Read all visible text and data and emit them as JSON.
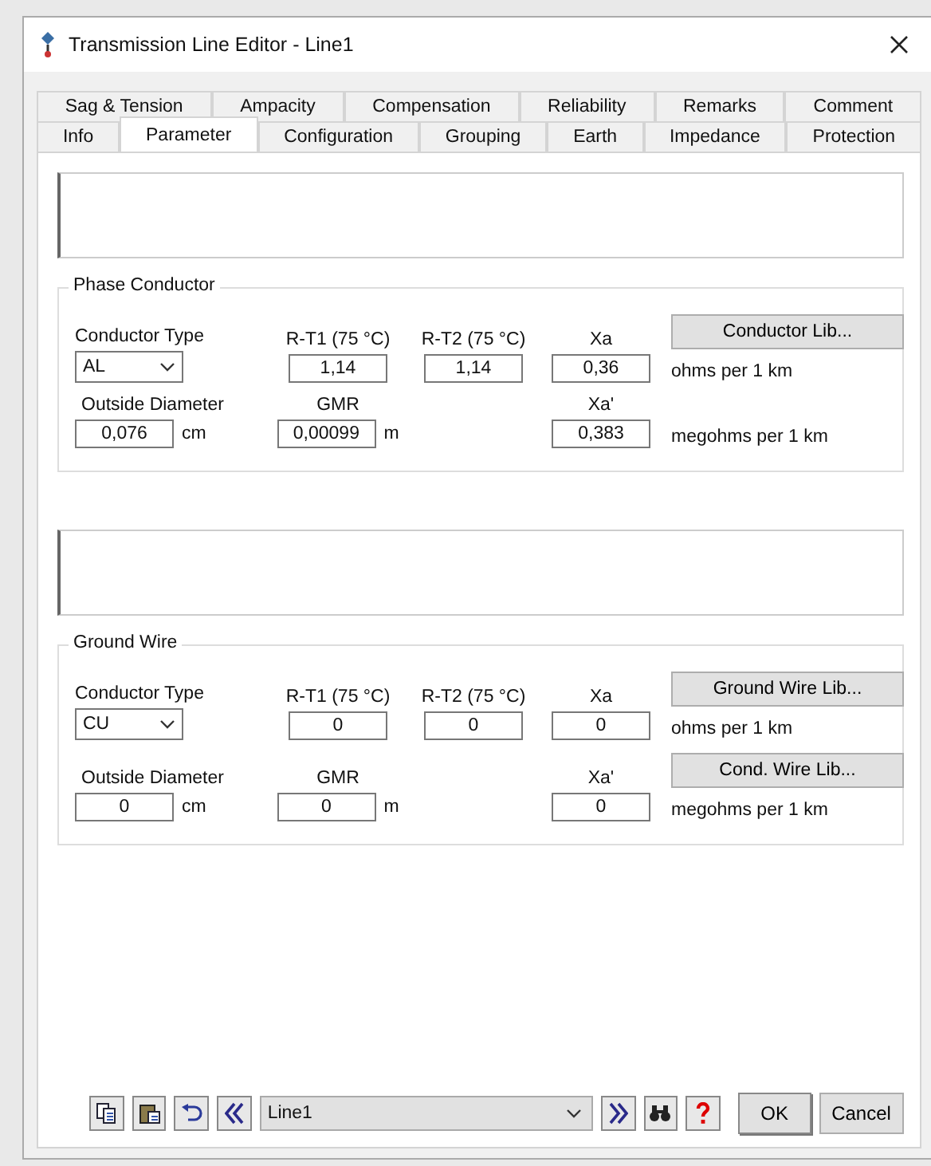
{
  "window": {
    "title": "Transmission Line Editor - Line1"
  },
  "tab_rows": [
    {
      "tabs": [
        {
          "label": "Sag & Tension",
          "selected": false
        },
        {
          "label": "Ampacity",
          "selected": false
        },
        {
          "label": "Compensation",
          "selected": false
        },
        {
          "label": "Reliability",
          "selected": false
        },
        {
          "label": "Remarks",
          "selected": false
        },
        {
          "label": "Comment",
          "selected": false
        }
      ]
    },
    {
      "tabs": [
        {
          "label": "Info",
          "selected": false
        },
        {
          "label": "Parameter",
          "selected": true
        },
        {
          "label": "Configuration",
          "selected": false
        },
        {
          "label": "Grouping",
          "selected": false
        },
        {
          "label": "Earth",
          "selected": false
        },
        {
          "label": "Impedance",
          "selected": false
        },
        {
          "label": "Protection",
          "selected": false
        }
      ]
    }
  ],
  "sections": [
    {
      "title": "Phase Conductor",
      "rows": [
        {
          "cells": [
            {
              "kind": "select",
              "label": "Conductor Type",
              "value": "AL"
            },
            {
              "kind": "input",
              "label": "R-T1 (75 °C)",
              "value": "1,14"
            },
            {
              "kind": "input",
              "label": "R-T2 (75 °C)",
              "value": "1,14"
            },
            {
              "kind": "input",
              "label": "Xa",
              "value": "0,36"
            }
          ],
          "buttons": [
            "Conductor Lib..."
          ],
          "unit": "ohms per 1 km"
        },
        {
          "cells": [
            {
              "kind": "input",
              "label": "Outside Diameter",
              "value": "0,076",
              "unit": "cm"
            },
            {
              "kind": "input",
              "label": "GMR",
              "value": "0,00099",
              "unit": "m"
            },
            {
              "kind": "empty"
            },
            {
              "kind": "input",
              "label": "Xa'",
              "value": "0,383"
            }
          ],
          "buttons": [],
          "unit": "megohms per 1 km"
        }
      ]
    },
    {
      "title": "Ground Wire",
      "rows": [
        {
          "cells": [
            {
              "kind": "select",
              "label": "Conductor Type",
              "value": "CU"
            },
            {
              "kind": "input",
              "label": "R-T1 (75 °C)",
              "value": "0"
            },
            {
              "kind": "input",
              "label": "R-T2 (75 °C)",
              "value": "0"
            },
            {
              "kind": "input",
              "label": "Xa",
              "value": "0"
            }
          ],
          "buttons": [
            "Ground Wire Lib..."
          ],
          "unit": "ohms per 1 km"
        },
        {
          "cells": [
            {
              "kind": "input",
              "label": "Outside Diameter",
              "value": "0",
              "unit": "cm"
            },
            {
              "kind": "input",
              "label": "GMR",
              "value": "0",
              "unit": "m"
            },
            {
              "kind": "empty"
            },
            {
              "kind": "input",
              "label": "Xa'",
              "value": "0"
            }
          ],
          "buttons": [
            "Cond. Wire Lib..."
          ],
          "unit": "megohms per 1 km"
        }
      ]
    }
  ],
  "footer": {
    "line": "Line1",
    "ok": "OK",
    "cancel": "Cancel"
  }
}
